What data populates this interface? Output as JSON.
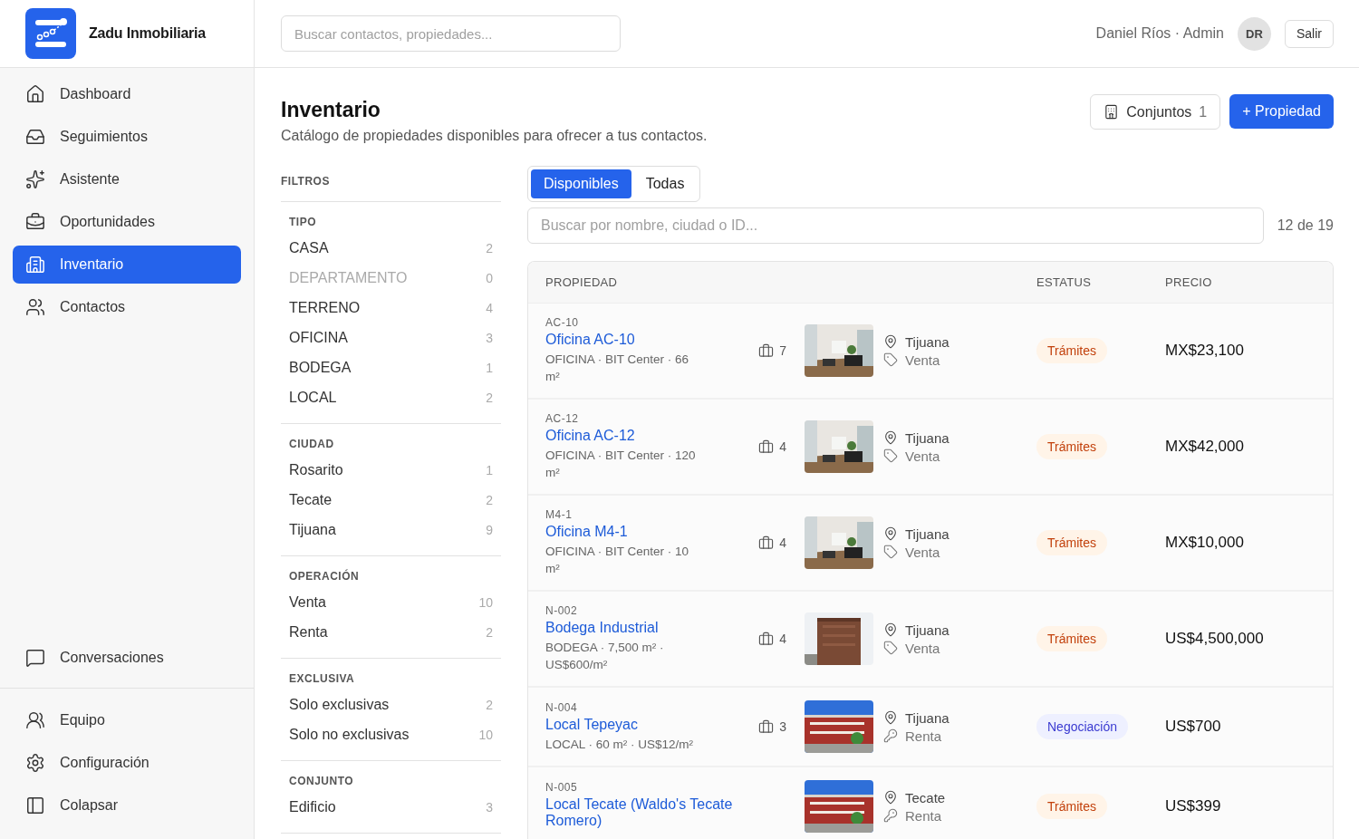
{
  "brand": {
    "name": "Zadu Inmobiliaria"
  },
  "sidebar": {
    "items": [
      {
        "label": "Dashboard",
        "selected": false
      },
      {
        "label": "Seguimientos",
        "selected": false
      },
      {
        "label": "Asistente",
        "selected": false
      },
      {
        "label": "Oportunidades",
        "selected": false
      },
      {
        "label": "Inventario",
        "selected": true
      },
      {
        "label": "Contactos",
        "selected": false
      }
    ],
    "lower_items": [
      {
        "label": "Conversaciones",
        "selected": false
      }
    ],
    "footer_items": [
      {
        "label": "Equipo"
      },
      {
        "label": "Configuración"
      },
      {
        "label": "Colapsar"
      }
    ]
  },
  "topbar": {
    "search": {
      "placeholder": "Buscar contactos, propiedades..."
    },
    "user": "Daniel Ríos · Admin",
    "avatar": "DR",
    "logout": "Salir"
  },
  "page": {
    "title": "Inventario",
    "subtitle": "Catálogo de propiedades disponibles para ofrecer a tus contactos.",
    "sets_button": {
      "label": "Conjuntos",
      "count": "1"
    },
    "add_button": "+ Propiedad"
  },
  "filters": {
    "title": "FILTROS",
    "groups": [
      {
        "title": "TIPO",
        "options": [
          {
            "label": "CASA",
            "count": "2",
            "disabled": false
          },
          {
            "label": "DEPARTAMENTO",
            "count": "0",
            "disabled": true
          },
          {
            "label": "TERRENO",
            "count": "4",
            "disabled": false
          },
          {
            "label": "OFICINA",
            "count": "3",
            "disabled": false
          },
          {
            "label": "BODEGA",
            "count": "1",
            "disabled": false
          },
          {
            "label": "LOCAL",
            "count": "2",
            "disabled": false
          }
        ]
      },
      {
        "title": "CIUDAD",
        "options": [
          {
            "label": "Rosarito",
            "count": "1",
            "disabled": false
          },
          {
            "label": "Tecate",
            "count": "2",
            "disabled": false
          },
          {
            "label": "Tijuana",
            "count": "9",
            "disabled": false
          }
        ]
      },
      {
        "title": "OPERACIÓN",
        "options": [
          {
            "label": "Venta",
            "count": "10",
            "disabled": false
          },
          {
            "label": "Renta",
            "count": "2",
            "disabled": false
          }
        ]
      },
      {
        "title": "EXCLUSIVA",
        "options": [
          {
            "label": "Solo exclusivas",
            "count": "2",
            "disabled": false
          },
          {
            "label": "Solo no exclusivas",
            "count": "10",
            "disabled": false
          }
        ]
      },
      {
        "title": "CONJUNTO",
        "options": [
          {
            "label": "Edificio",
            "count": "3",
            "disabled": false
          }
        ]
      }
    ]
  },
  "tabs": [
    {
      "label": "Disponibles",
      "selected": true
    },
    {
      "label": "Todas",
      "selected": false
    }
  ],
  "table_search": {
    "placeholder": "Buscar por nombre, ciudad o ID...",
    "count": "12 de 19"
  },
  "table": {
    "columns": [
      "PROPIEDAD",
      "ESTATUS",
      "PRECIO"
    ],
    "rows": [
      {
        "id": "AC-10",
        "name": "Oficina AC-10",
        "meta": "OFICINA · BIT Center · 66 m²",
        "opportunities": "7",
        "city": "Tijuana",
        "operation": {
          "label": "Venta",
          "kind": "sale"
        },
        "status": {
          "label": "Trámites",
          "kind": "warning"
        },
        "price": "MX$23,100"
      },
      {
        "id": "AC-12",
        "name": "Oficina AC-12",
        "meta": "OFICINA · BIT Center · 120 m²",
        "opportunities": "4",
        "city": "Tijuana",
        "operation": {
          "label": "Venta",
          "kind": "sale"
        },
        "status": {
          "label": "Trámites",
          "kind": "warning"
        },
        "price": "MX$42,000"
      },
      {
        "id": "M4-1",
        "name": "Oficina M4-1",
        "meta": "OFICINA · BIT Center · 10 m²",
        "opportunities": "4",
        "city": "Tijuana",
        "operation": {
          "label": "Venta",
          "kind": "sale"
        },
        "status": {
          "label": "Trámites",
          "kind": "warning"
        },
        "price": "MX$10,000"
      },
      {
        "id": "N-002",
        "name": "Bodega Industrial",
        "meta": "BODEGA · 7,500 m² · US$600/m²",
        "opportunities": "4",
        "city": "Tijuana",
        "operation": {
          "label": "Venta",
          "kind": "sale"
        },
        "status": {
          "label": "Trámites",
          "kind": "warning"
        },
        "price": "US$4,500,000"
      },
      {
        "id": "N-004",
        "name": "Local Tepeyac",
        "meta": "LOCAL · 60 m² · US$12/m²",
        "opportunities": "3",
        "city": "Tijuana",
        "operation": {
          "label": "Renta",
          "kind": "rent"
        },
        "status": {
          "label": "Negociación",
          "kind": "info"
        },
        "price": "US$700"
      },
      {
        "id": "N-005",
        "name": "Local Tecate (Waldo's Tecate Romero)",
        "city": "Tecate",
        "operation": {
          "label": "Renta",
          "kind": "rent"
        },
        "status": {
          "label": "Trámites",
          "kind": "warning"
        },
        "price": "US$399"
      }
    ]
  }
}
